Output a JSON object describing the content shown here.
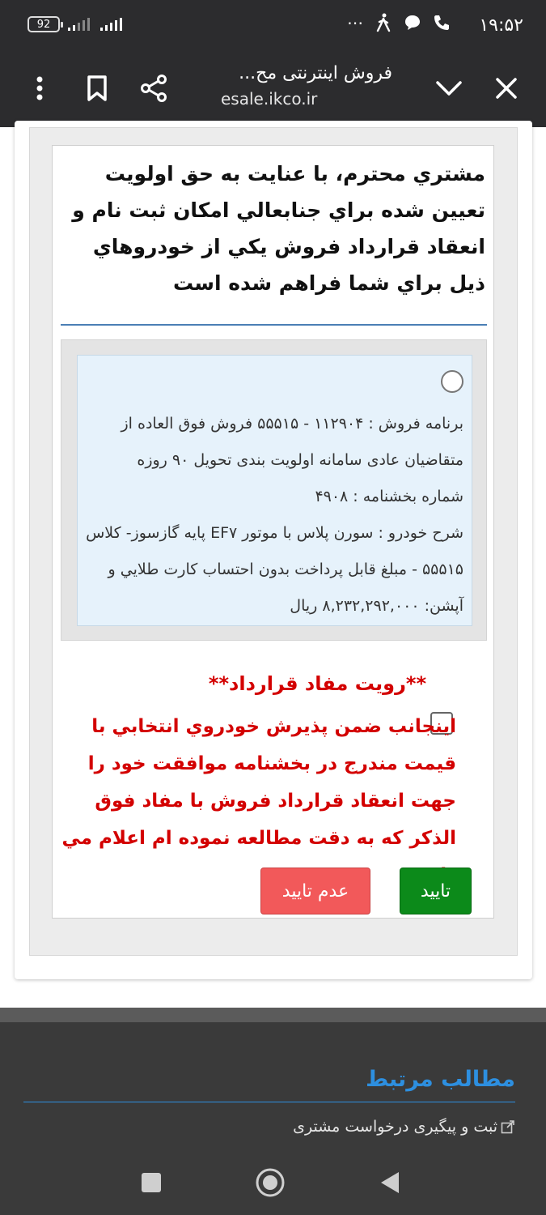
{
  "status_bar": {
    "time": "۱۹:۵۲",
    "battery": "92",
    "more": "⋯"
  },
  "browser": {
    "title": "فروش اینترنتی مح...",
    "url": "esale.ikco.ir"
  },
  "intro_text": "مشتري محترم، با عنايت به حق اولويت تعيين شده براي جنابعالي امكان ثبت نام و انعقاد قرارداد فروش يكي از خودروهاي ذيل براي شما فراهم شده است",
  "option": {
    "line1": "برنامه فروش : ۱۱۲۹۰۴ - ۵۵۵۱۵ فروش فوق العاده از متقاضیان عادی سامانه اولویت بندی تحویل ۹۰ روزه",
    "line2": "شماره بخشنامه : ۴۹۰۸",
    "line3": "شرح خودرو : سورن پلاس با موتور EF۷ پایه گازسوز- کلاس ۵۵۵۱۵ - مبلغ قابل پرداخت بدون احتساب کارت طلايي و آپشن: ۸,۲۳۲,۲۹۲,۰۰۰ ريال"
  },
  "review": {
    "title": "**رويت مفاد قرارداد**",
    "agreement": "اينجانب ضمن پذيرش خودروي انتخابي با قيمت مندرج در بخشنامه موافقت خود را جهت انعقاد قرارداد فروش با مفاد فوق الذكر كه به دقت مطالعه نموده ام اعلام مي دارم."
  },
  "buttons": {
    "confirm": "تاييد",
    "reject": "عدم تاييد"
  },
  "footer": {
    "related_title": "مطالب مرتبط",
    "related_link": "ثبت و پیگیری درخواست مشتری"
  },
  "colors": {
    "confirm": "#0c8a1a",
    "reject": "#f2595a",
    "warning_text": "#d30000",
    "link": "#2d8fe0"
  }
}
